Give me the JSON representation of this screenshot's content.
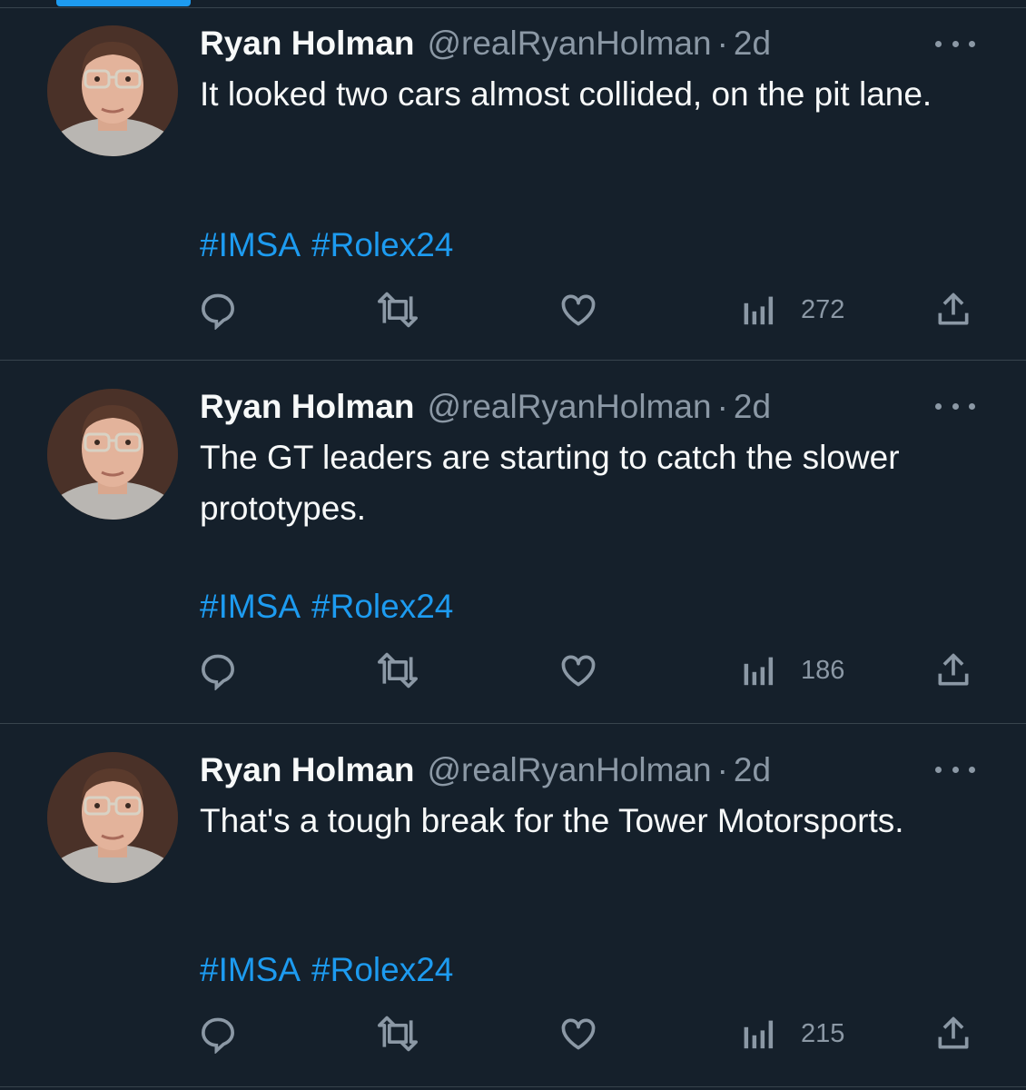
{
  "tweets": [
    {
      "author": "Ryan Holman",
      "handle": "@realRyanHolman",
      "separator": "·",
      "time": "2d",
      "text": "It looked two cars almost collided, on the pit lane.",
      "hashtags": [
        "#IMSA",
        "#Rolex24"
      ],
      "views": "272"
    },
    {
      "author": "Ryan Holman",
      "handle": "@realRyanHolman",
      "separator": "·",
      "time": "2d",
      "text": "The GT leaders are starting to catch the slower prototypes.",
      "hashtags": [
        "#IMSA",
        "#Rolex24"
      ],
      "views": "186"
    },
    {
      "author": "Ryan Holman",
      "handle": "@realRyanHolman",
      "separator": "·",
      "time": "2d",
      "text": "That's a tough break for the Tower Motorsports.",
      "hashtags": [
        "#IMSA",
        "#Rolex24"
      ],
      "views": "215"
    }
  ],
  "icons": {
    "reply": "reply-icon",
    "retweet": "retweet-icon",
    "like": "like-icon",
    "views": "views-icon",
    "share": "share-icon",
    "more": "more-icon"
  },
  "colors": {
    "background": "#15202b",
    "text": "#f7f9f9",
    "secondary": "#8b98a5",
    "accent": "#1d9bf0",
    "divider": "#38444d"
  }
}
